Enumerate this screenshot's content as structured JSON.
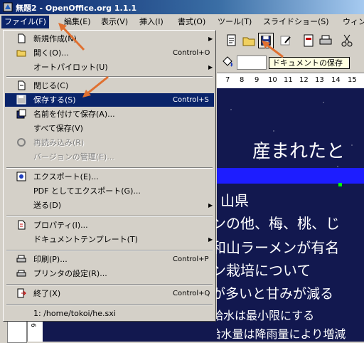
{
  "window": {
    "title": "無題2 - OpenOffice.org 1.1.1"
  },
  "menubar": {
    "items": [
      "ファイル(F)",
      "編集(E)",
      "表示(V)",
      "挿入(I)",
      "書式(O)",
      "ツール(T)",
      "スライドショー(S)",
      "ウィン"
    ]
  },
  "file_menu": {
    "items": [
      {
        "label": "新規作成(N)",
        "shortcut": "",
        "submenu": true,
        "icon": "new-document-icon"
      },
      {
        "label": "開く(O)...",
        "shortcut": "Control+O",
        "submenu": false,
        "icon": "open-folder-icon"
      },
      {
        "label": "オートパイロット(U)",
        "shortcut": "",
        "submenu": true,
        "icon": ""
      },
      {
        "label": "閉じる(C)",
        "shortcut": "",
        "submenu": false,
        "icon": "close-document-icon"
      },
      {
        "label": "保存する(S)",
        "shortcut": "Control+S",
        "submenu": false,
        "icon": "save-floppy-icon"
      },
      {
        "label": "名前を付けて保存(A)...",
        "shortcut": "",
        "submenu": false,
        "icon": "save-as-icon"
      },
      {
        "label": "すべて保存(V)",
        "shortcut": "",
        "submenu": false,
        "icon": ""
      },
      {
        "label": "再読み込み(R)",
        "shortcut": "",
        "submenu": false,
        "icon": "reload-icon"
      },
      {
        "label": "バージョンの管理(E)...",
        "shortcut": "",
        "submenu": false,
        "icon": ""
      },
      {
        "label": "エクスポート(E)...",
        "shortcut": "",
        "submenu": false,
        "icon": "export-icon"
      },
      {
        "label": "PDF としてエクスポート(G)...",
        "shortcut": "",
        "submenu": false,
        "icon": ""
      },
      {
        "label": "送る(D)",
        "shortcut": "",
        "submenu": true,
        "icon": ""
      },
      {
        "label": "プロパティ(I)...",
        "shortcut": "",
        "submenu": false,
        "icon": "properties-icon"
      },
      {
        "label": "ドキュメントテンプレート(T)",
        "shortcut": "",
        "submenu": true,
        "icon": ""
      },
      {
        "label": "印刷(P)...",
        "shortcut": "Control+P",
        "submenu": false,
        "icon": "print-icon"
      },
      {
        "label": "プリンタの設定(R)...",
        "shortcut": "",
        "submenu": false,
        "icon": "printer-settings-icon"
      },
      {
        "label": "終了(X)",
        "shortcut": "Control+Q",
        "submenu": false,
        "icon": "exit-icon"
      },
      {
        "label": "1: /home/tokoi/he.sxi",
        "shortcut": "",
        "submenu": false,
        "icon": ""
      }
    ]
  },
  "tooltip": {
    "text": "ドキュメントの保存"
  },
  "ruler": {
    "ticks": [
      "7",
      "8",
      "9",
      "10",
      "11",
      "12",
      "13",
      "14",
      "15"
    ]
  },
  "slide": {
    "title": "産まれたと",
    "bullets": [
      "山県",
      "ンの他、梅、桃、じ",
      "和山ラーメンが有名",
      "ン栽培について",
      "が多いと甘みが減る",
      "給水は最小限にする",
      "• 給水量は降雨量により増減"
    ]
  },
  "slide_panel": {
    "number": "6"
  },
  "colors": {
    "accent": "#0a246a",
    "slide_bg": "#12184f",
    "band": "#1d1dff",
    "arrow": "#e07030"
  }
}
